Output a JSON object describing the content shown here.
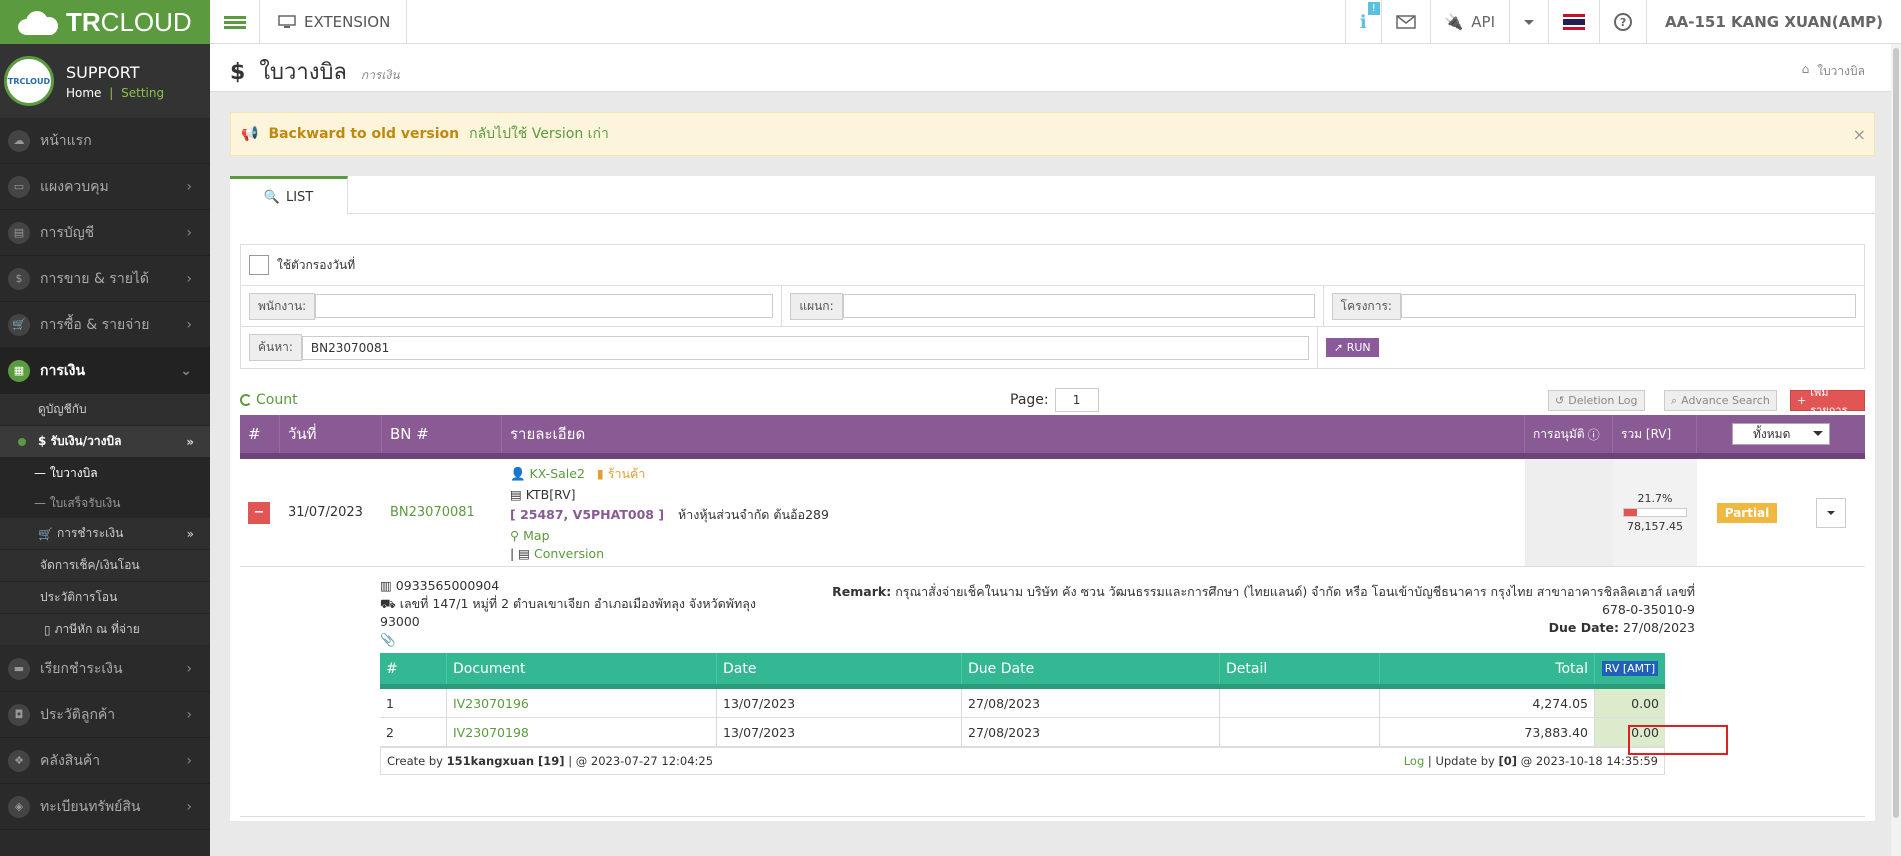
{
  "brand": {
    "name_bold": "TR",
    "name_light": "CLOUD"
  },
  "topbar": {
    "extension": "EXTENSION",
    "notif_count": "!",
    "api": "API",
    "user": "AA-151 KANG XUAN(AMP)"
  },
  "profile": {
    "name": "SUPPORT",
    "home": "Home",
    "sep": "|",
    "setting": "Setting",
    "avatar_text": "TRCLOUD"
  },
  "sidebar": {
    "items": [
      {
        "label": "หน้าแรก"
      },
      {
        "label": "แผงควบคุม"
      },
      {
        "label": "การบัญชี"
      },
      {
        "label": "การขาย & รายได้"
      },
      {
        "label": "การซื้อ & รายจ่าย"
      },
      {
        "label": "การเงิน"
      }
    ],
    "finance_sub": [
      {
        "label": "ดูบัญชีกับ"
      },
      {
        "label": "$ รับเงิน/วางบิล"
      }
    ],
    "finance_sub2": [
      {
        "label": "— ใบวางบิล"
      },
      {
        "label": "— ใบเสร็จรับเงิน"
      }
    ],
    "finance_more": [
      {
        "label": "การชำระเงิน"
      },
      {
        "label": "จัดการเช็ค/เงินโอน"
      },
      {
        "label": "ประวัติการโอน"
      },
      {
        "label": "ภาษีหัก ณ ที่จ่าย"
      }
    ],
    "bottom": [
      {
        "label": "เรียกชำระเงิน"
      },
      {
        "label": "ประวัติลูกค้า"
      },
      {
        "label": "คลังสินค้า"
      },
      {
        "label": "ทะเบียนทรัพย์สิน"
      }
    ]
  },
  "header": {
    "title": "ใบวางบิล",
    "subtitle": "การเงิน",
    "crumb": "ใบวางบิล"
  },
  "alert": {
    "bold": "Backward to old version",
    "link": "กลับไปใช้ Version เก่า",
    "close": "×"
  },
  "tab": {
    "label": "LIST"
  },
  "filter": {
    "date_filter": "ใช้ตัวกรองวันที่",
    "employee_label": "พนักงาน:",
    "employee_value": "",
    "dept_label": "แผนก:",
    "dept_value": "",
    "project_label": "โครงการ:",
    "project_value": "",
    "search_label": "ค้นหา:",
    "search_value": "BN23070081",
    "run": "RUN"
  },
  "toolbar": {
    "count": "Count",
    "page_label": "Page:",
    "page_value": "1",
    "deletion_log": "Deletion Log",
    "advance_search": "Advance Search",
    "add": "เพิ่มรายการ"
  },
  "table": {
    "headers": {
      "num": "#",
      "date": "วันที่",
      "bn": "BN #",
      "detail": "รายละเอียด",
      "approval": "การอนุมัติ",
      "total": "รวม [RV]",
      "filter_select": "ทั้งหมด"
    },
    "row": {
      "date": "31/07/2023",
      "bn": "BN23070081",
      "sales": "KX-Sale2",
      "shop": "ร้านค้า",
      "bank": "KTB[RV]",
      "code": "[ 25487, V5PHAT008 ]",
      "customer": "ห้างหุ้นส่วนจำกัด ต้นอ้อ289",
      "map": "Map",
      "conversion": "Conversion",
      "percent": "21.7%",
      "percent_value": 21.7,
      "amount": "78,157.45",
      "status": "Partial"
    }
  },
  "expanded": {
    "phone": "0933565000904",
    "address": "เลขที่ 147/1 หมู่ที่ 2 ตำบลเขาเจียก อำเภอเมืองพัทลุง จังหวัดพัทลุง 93000",
    "remark_label": "Remark:",
    "remark": "กรุณาสั่งจ่ายเช็คในนาม บริษัท คัง ซวน วัฒนธรรมและการศึกษา (ไทยแลนด์) จำกัด หรือ โอนเข้าบัญชีธนาคาร กรุงไทย สาขาอาคารชิลลิคเฮาส์ เลขที่ 678-0-35010-9",
    "due_label": "Due Date:",
    "due": "27/08/2023",
    "headers": {
      "num": "#",
      "doc": "Document",
      "date": "Date",
      "due": "Due Date",
      "detail": "Detail",
      "total": "Total",
      "rv": "RV [AMT]"
    },
    "rows": [
      {
        "num": "1",
        "doc": "IV23070196",
        "date": "13/07/2023",
        "due": "27/08/2023",
        "detail": "",
        "total": "4,274.05",
        "rv": "0.00"
      },
      {
        "num": "2",
        "doc": "IV23070198",
        "date": "13/07/2023",
        "due": "27/08/2023",
        "detail": "",
        "total": "73,883.40",
        "rv": "0.00"
      }
    ],
    "footer": {
      "create_prefix": "Create by",
      "create_user": "151kangxuan [19]",
      "create_time": "| @ 2023-07-27 12:04:25",
      "log": "Log",
      "update_prefix": "| Update by",
      "update_user": "[0]",
      "update_time": "@ 2023-10-18 14:35:59"
    }
  },
  "colors": {
    "brand": "#5b9a3e",
    "header_purple": "#8a5a94",
    "inner_green": "#34b894",
    "danger": "#e25555",
    "warning": "#f0b840"
  }
}
